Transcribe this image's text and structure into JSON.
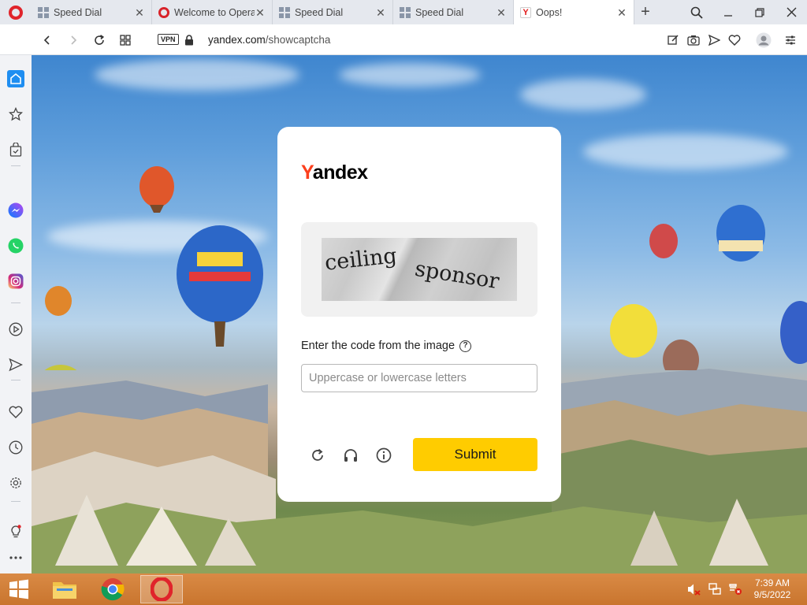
{
  "browser": {
    "tabs": [
      {
        "label": "Speed Dial",
        "icon": "speed-dial-icon"
      },
      {
        "label": "Welcome to Opera",
        "icon": "opera-icon"
      },
      {
        "label": "Speed Dial",
        "icon": "speed-dial-icon"
      },
      {
        "label": "Speed Dial",
        "icon": "speed-dial-icon"
      },
      {
        "label": "Oops!",
        "icon": "yandex-icon",
        "active": true
      }
    ],
    "vpn_label": "VPN",
    "url_host": "yandex.com",
    "url_path": "/showcaptcha"
  },
  "sidebar": {
    "items": [
      "home-icon",
      "star-icon",
      "bag-icon",
      "messenger-icon",
      "whatsapp-icon",
      "instagram-icon",
      "player-icon",
      "send-icon",
      "heart-icon",
      "history-icon",
      "settings-icon",
      "lightbulb-icon",
      "more-icon"
    ]
  },
  "captcha": {
    "logo_first": "Y",
    "logo_rest": "andex",
    "image_words": [
      "ceiling",
      "sponsor"
    ],
    "prompt": "Enter the code from the image",
    "input_placeholder": "Uppercase or lowercase letters",
    "input_value": "",
    "submit_label": "Submit"
  },
  "taskbar": {
    "time": "7:39 AM",
    "date": "9/5/2022"
  },
  "colors": {
    "accent_yellow": "#ffcc00",
    "yandex_red": "#fc3f1d",
    "opera_red": "#e0242b",
    "taskbar": "#c9752e"
  }
}
